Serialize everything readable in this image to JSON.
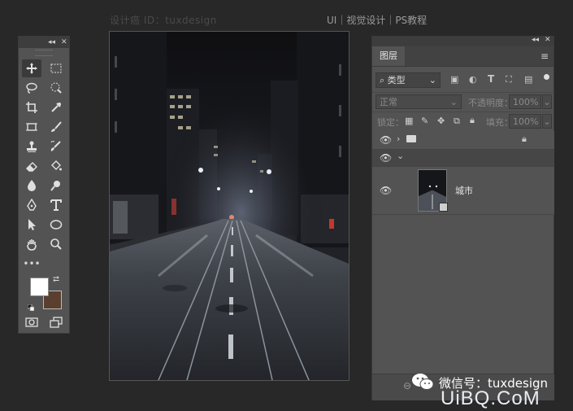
{
  "watermark_top": "设计癌 ID：tuxdesign",
  "tagline": "UI｜视觉设计｜PS教程",
  "toolbar": {
    "collapse_glyph": "◂◂",
    "close_glyph": "✕",
    "more_tools": "•••"
  },
  "layers_panel": {
    "tab_label": "图层",
    "filter_kind": "类型",
    "blend_mode": "正常",
    "opacity_label": "不透明度：",
    "opacity_value": "100%",
    "lock_label": "锁定：",
    "fill_label": "填充：",
    "fill_value": "100%",
    "layers": [
      {
        "type": "group",
        "name": ""
      },
      {
        "type": "group-open",
        "name": ""
      },
      {
        "type": "image",
        "name": "城市"
      }
    ]
  },
  "watermark_bottom": {
    "wechat": "微信号：tuxdesign",
    "site": "UiBQ.CoM"
  },
  "colors": {
    "foreground": "#ffffff",
    "background": "#5a3e2e",
    "panel": "#535353",
    "app_bg": "#282828"
  }
}
